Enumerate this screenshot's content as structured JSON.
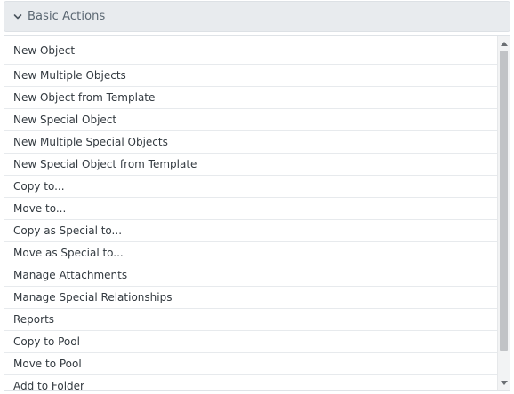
{
  "section": {
    "title": "Basic Actions",
    "chevron_icon": "chevron-down-icon",
    "expanded": true
  },
  "actions": [
    {
      "label": "New Object"
    },
    {
      "label": "New Multiple Objects"
    },
    {
      "label": "New Object from Template"
    },
    {
      "label": "New Special Object"
    },
    {
      "label": "New Multiple Special Objects"
    },
    {
      "label": "New Special Object from Template"
    },
    {
      "label": "Copy to..."
    },
    {
      "label": "Move to..."
    },
    {
      "label": "Copy as Special to..."
    },
    {
      "label": "Move as Special to..."
    },
    {
      "label": "Manage Attachments"
    },
    {
      "label": "Manage Special Relationships"
    },
    {
      "label": "Reports"
    },
    {
      "label": "Copy to Pool"
    },
    {
      "label": "Move to Pool"
    },
    {
      "label": "Add to Folder"
    }
  ],
  "colors": {
    "header_bg": "#e8ebee",
    "header_text": "#5b6772",
    "row_text": "#333a40",
    "row_divider": "#e7eaed"
  }
}
